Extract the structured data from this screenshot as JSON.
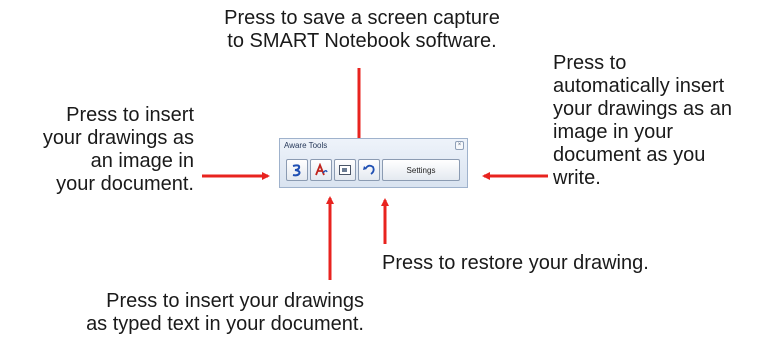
{
  "callouts": {
    "save_capture": "Press to save a screen capture\nto SMART Notebook software.",
    "insert_image": "Press to insert\nyour drawings as\nan image in\nyour document.",
    "auto_insert": "Press to\nautomatically insert\nyour drawings as an\nimage in your\ndocument as you\nwrite.",
    "insert_text": "Press to insert your drawings\nas typed text in your document.",
    "restore": "Press to restore your drawing."
  },
  "toolbar": {
    "title": "Aware Tools",
    "settings_label": "Settings",
    "buttons": [
      "insert-image-icon",
      "insert-text-icon",
      "screen-capture-icon",
      "restore-icon"
    ]
  },
  "colors": {
    "arrow": "#e8231f",
    "text": "#1a1a1a",
    "toolbar_border": "#9fb2cc"
  }
}
